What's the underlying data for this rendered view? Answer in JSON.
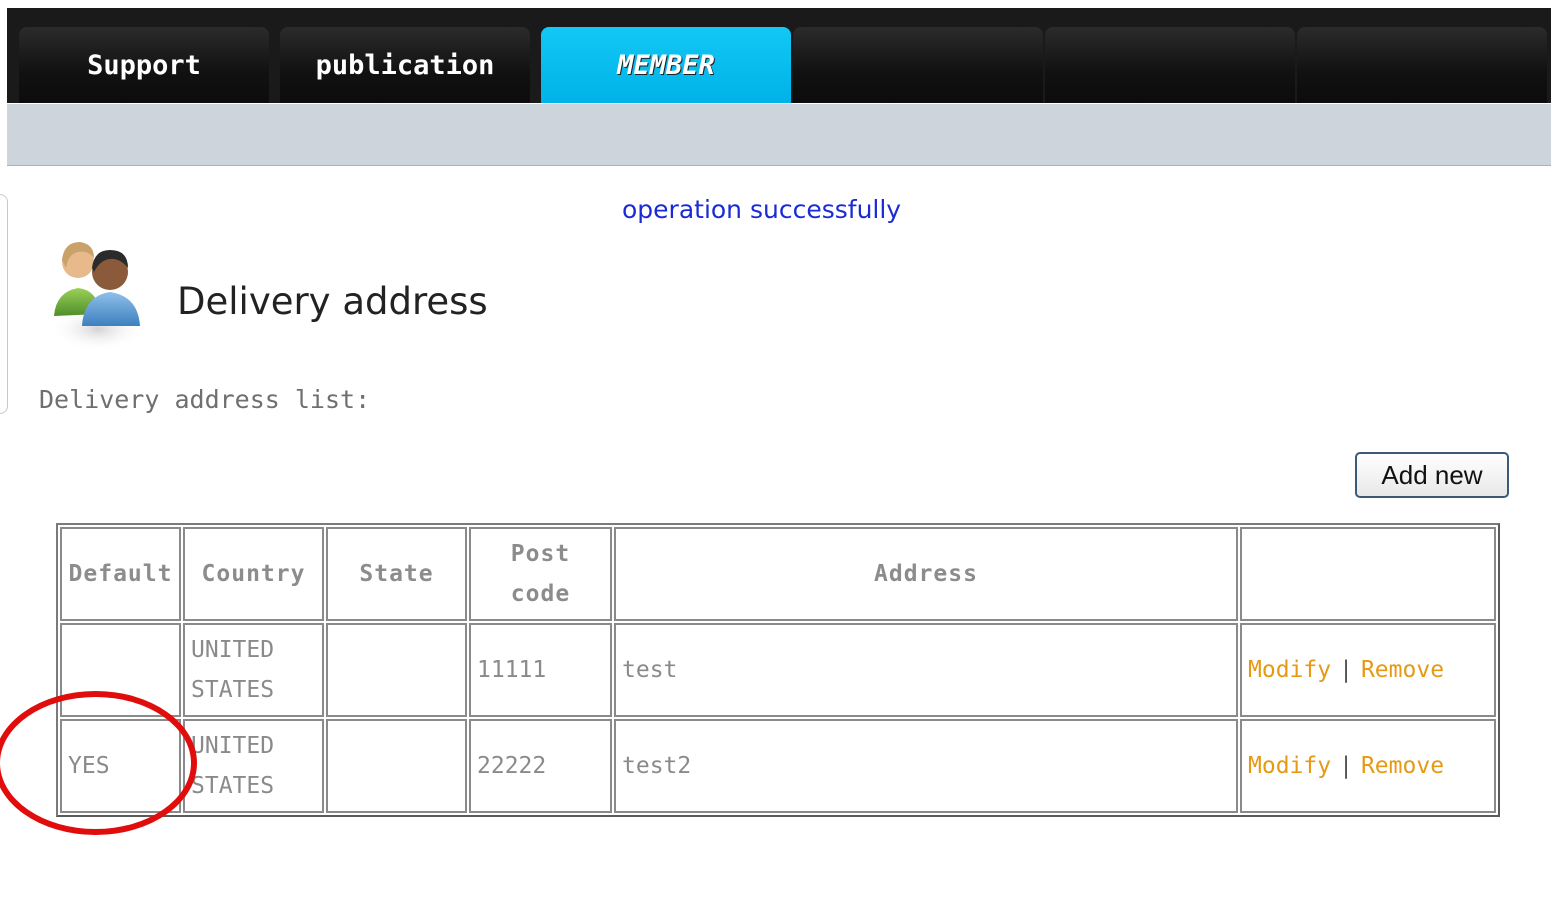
{
  "nav": {
    "tabs": [
      {
        "label": "Support",
        "active": false
      },
      {
        "label": "publication",
        "active": false
      },
      {
        "label": "MEMBER",
        "active": true
      },
      {
        "label": "",
        "active": false
      },
      {
        "label": "",
        "active": false
      },
      {
        "label": "",
        "active": false
      }
    ]
  },
  "message": "operation successfully",
  "page": {
    "title": "Delivery address",
    "icon": "users-icon",
    "list_label": "Delivery address list:"
  },
  "toolbar": {
    "add_new_label": "Add new"
  },
  "table": {
    "headers": [
      "Default",
      "Country",
      "State",
      "Post code",
      "Address",
      ""
    ],
    "rows": [
      {
        "default": "",
        "country": "UNITED STATES",
        "state": "",
        "post_code": "11111",
        "address": "test",
        "modify": "Modify",
        "separator": "|",
        "remove": "Remove"
      },
      {
        "default": "YES",
        "country": "UNITED STATES",
        "state": "",
        "post_code": "22222",
        "address": "test2",
        "modify": "Modify",
        "separator": "|",
        "remove": "Remove"
      }
    ]
  },
  "colors": {
    "active_tab": "#00b2e8",
    "message": "#1a2bd6",
    "action_link": "#e69a14",
    "annotation": "#e10d0d"
  }
}
